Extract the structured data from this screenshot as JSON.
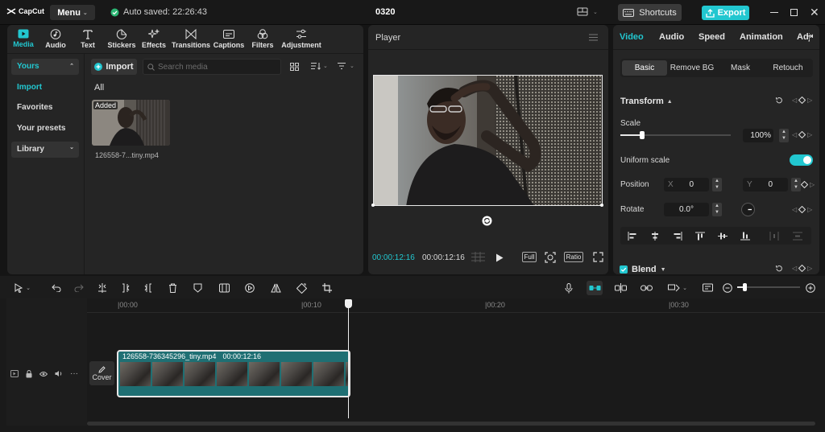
{
  "app": {
    "logo_text": "CapCut",
    "menu_label": "Menu",
    "autosave_text": "Auto saved: 22:26:43",
    "project_name": "0320",
    "shortcuts_label": "Shortcuts",
    "export_label": "Export"
  },
  "toolbar": {
    "items": [
      "Media",
      "Audio",
      "Text",
      "Stickers",
      "Effects",
      "Transitions",
      "Captions",
      "Filters",
      "Adjustment"
    ]
  },
  "sidebar": {
    "yours": "Yours",
    "import": "Import",
    "favorites": "Favorites",
    "presets": "Your presets",
    "library": "Library"
  },
  "media": {
    "import_button": "Import",
    "search_placeholder": "Search media",
    "filter_all": "All",
    "clip_badge": "Added",
    "clip_name": "126558-7...tiny.mp4"
  },
  "player": {
    "title": "Player",
    "current_time": "00:00:12:16",
    "total_time": "00:00:12:16",
    "full_label": "Full",
    "ratio_label": "Ratio"
  },
  "inspector": {
    "tabs": [
      "Video",
      "Audio",
      "Speed",
      "Animation",
      "Adjus"
    ],
    "subtabs": [
      "Basic",
      "Remove BG",
      "Mask",
      "Retouch"
    ],
    "transform_title": "Transform",
    "scale_label": "Scale",
    "scale_value": "100%",
    "scale_level": 0.2,
    "uniform_scale_label": "Uniform scale",
    "uniform_scale_on": true,
    "position_label": "Position",
    "pos_x_label": "X",
    "pos_x": "0",
    "pos_y_label": "Y",
    "pos_y": "0",
    "rotate_label": "Rotate",
    "rotate_value": "0.0°",
    "blend_label": "Blend"
  },
  "timeline": {
    "ruler": [
      "|00:00",
      "|00:10",
      "|00:20",
      "|00:30"
    ],
    "clip_name": "126558-736345296_tiny.mp4",
    "clip_duration": "00:00:12:16",
    "cover_label": "Cover"
  },
  "colors": {
    "accent": "#22c7d0",
    "track_clip": "#1f6f73",
    "panel": "#252525",
    "background": "#151515"
  }
}
